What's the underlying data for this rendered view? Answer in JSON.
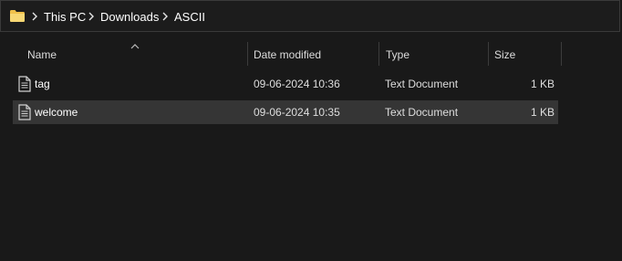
{
  "address_bar": {
    "folder_icon": "folder-icon",
    "separator_icon": "chevron-right-icon",
    "breadcrumbs": [
      "This PC",
      "Downloads",
      "ASCII"
    ]
  },
  "columns": {
    "name": "Name",
    "date_modified": "Date modified",
    "type": "Type",
    "size": "Size",
    "sort_indicator_icon": "sort-ascending-caret-icon"
  },
  "files": [
    {
      "icon": "text-document-icon",
      "name": "tag",
      "date_modified": "09-06-2024 10:36",
      "type": "Text Document",
      "size": "1 KB",
      "selected": false
    },
    {
      "icon": "text-document-icon",
      "name": "welcome",
      "date_modified": "09-06-2024 10:35",
      "type": "Text Document",
      "size": "1 KB",
      "selected": true
    }
  ],
  "colors": {
    "background": "#191919",
    "selected_row": "#353535",
    "folder_icon": "#f2c94c"
  }
}
